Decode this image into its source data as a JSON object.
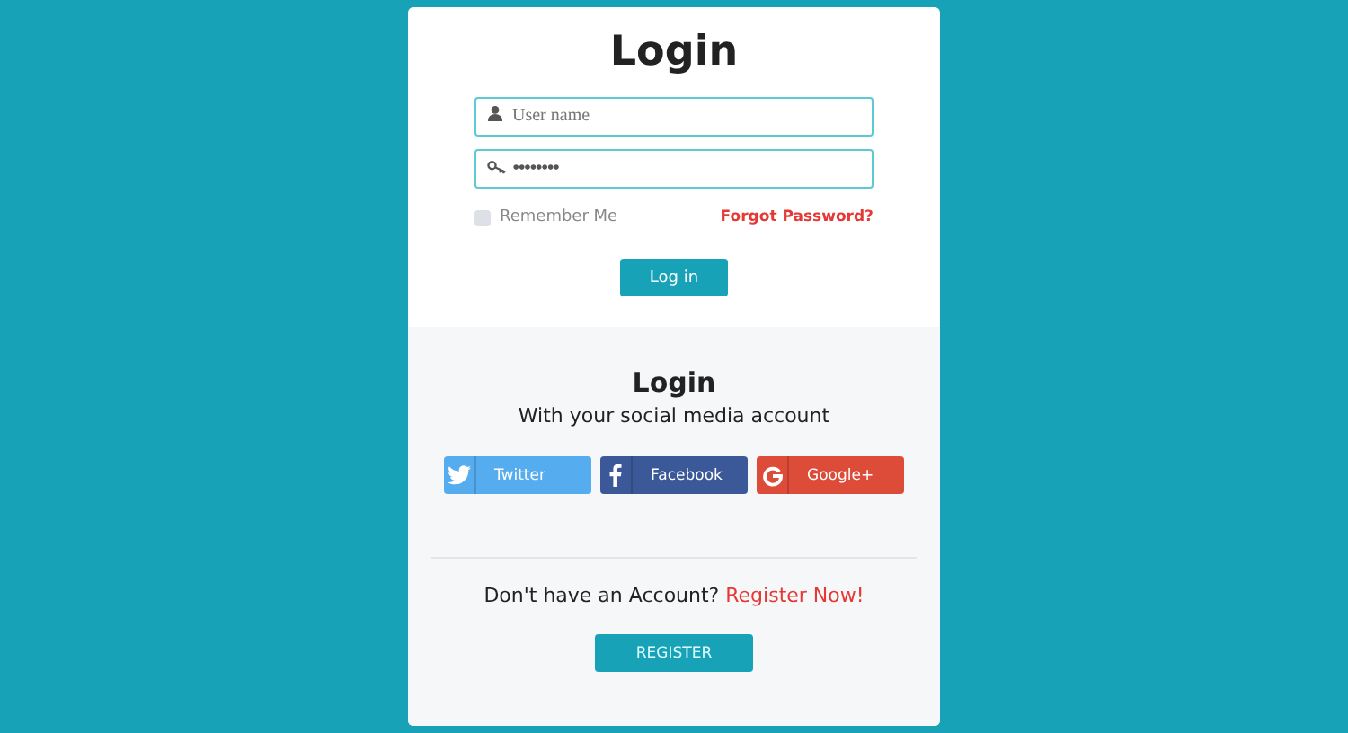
{
  "login": {
    "title": "Login",
    "username": {
      "placeholder": "User name"
    },
    "password": {
      "value": "••••••••"
    },
    "remember": {
      "label": "Remember Me",
      "checked": false
    },
    "forgot": "Forgot Password?",
    "submit": "Log in"
  },
  "social": {
    "title": "Login",
    "subtitle": "With your social media account",
    "buttons": [
      {
        "kind": "twitter",
        "label": "Twitter",
        "color": "#55acee"
      },
      {
        "kind": "facebook",
        "label": "Facebook",
        "color": "#3b5998"
      },
      {
        "kind": "google",
        "label": "Google+",
        "color": "#dd4b39"
      }
    ]
  },
  "register": {
    "question": "Don't have an Account?",
    "link": "Register Now!",
    "button": "REGISTER"
  }
}
